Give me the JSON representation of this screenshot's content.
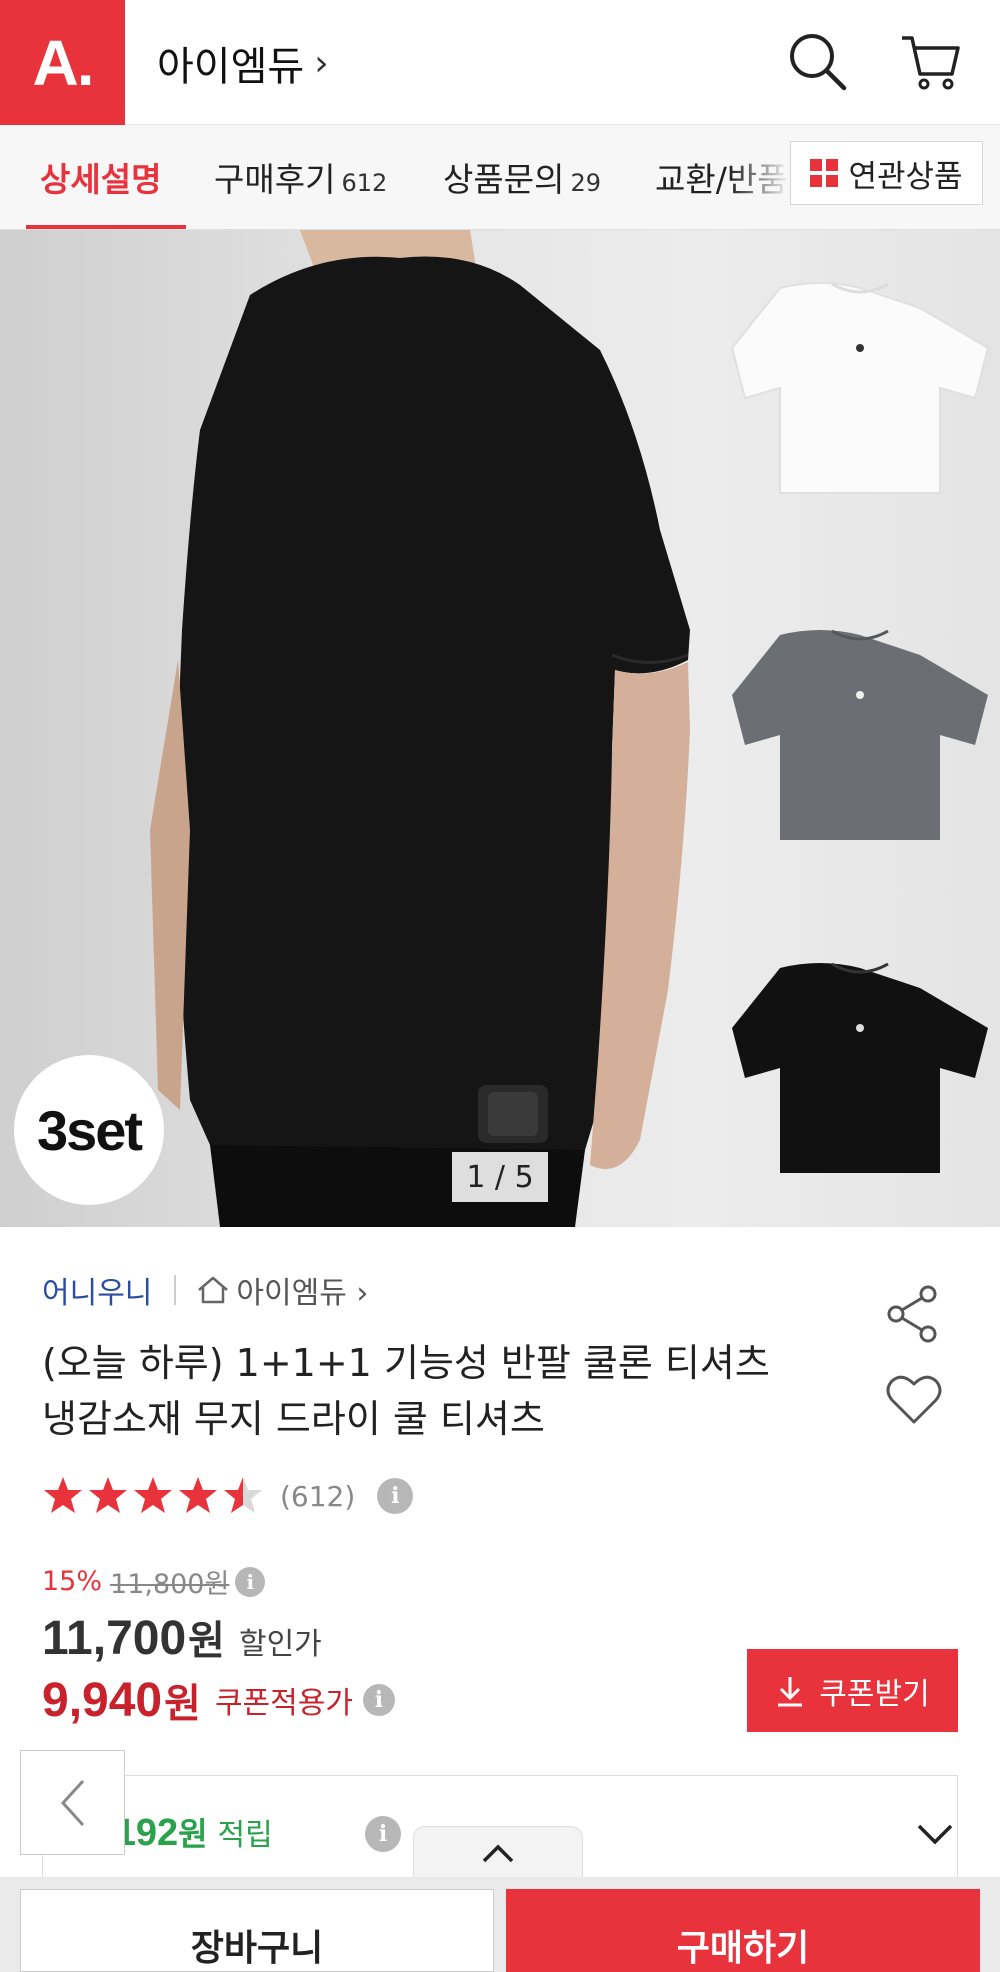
{
  "header": {
    "logo_text": "A.",
    "store_name": "아이엠듀",
    "store_chevron": "›"
  },
  "tabs": [
    {
      "label": "상세설명",
      "count": ""
    },
    {
      "label": "구매후기",
      "count": "612"
    },
    {
      "label": "상품문의",
      "count": "29"
    },
    {
      "label": "교환/반품",
      "count": ""
    }
  ],
  "related_button": {
    "label": "연관상품"
  },
  "gallery": {
    "badge": "3set",
    "page_indicator": "1 / 5",
    "shirt_colors": [
      "#ffffff",
      "#6b6e72",
      "#111111"
    ]
  },
  "product": {
    "seller": "어니우니",
    "store_link": "아이엠듀 ›",
    "title_line1": "(오늘 하루) 1+1+1 기능성 반팔 쿨론 티셔츠",
    "title_line2": "냉감소재 무지 드라이 쿨 티셔츠",
    "rating": 4.5,
    "review_count": "(612)"
  },
  "pricing": {
    "discount_pct": "15%",
    "original_price": "11,800원",
    "sale_price": "11,700",
    "sale_unit": "원",
    "sale_label": "할인가",
    "coupon_price": "9,940",
    "coupon_unit": "원",
    "coupon_label": "쿠폰적용가",
    "coupon_button": "쿠폰받기"
  },
  "points": {
    "amount": "1,192",
    "unit": "원",
    "label": "적립"
  },
  "bottom": {
    "cart_button": "장바구니",
    "buy_button": "구매하기"
  },
  "colors": {
    "brand_red": "#e8323c",
    "price_red": "#c8222c",
    "points_green": "#2aa14b",
    "seller_blue": "#2b4ea2"
  }
}
